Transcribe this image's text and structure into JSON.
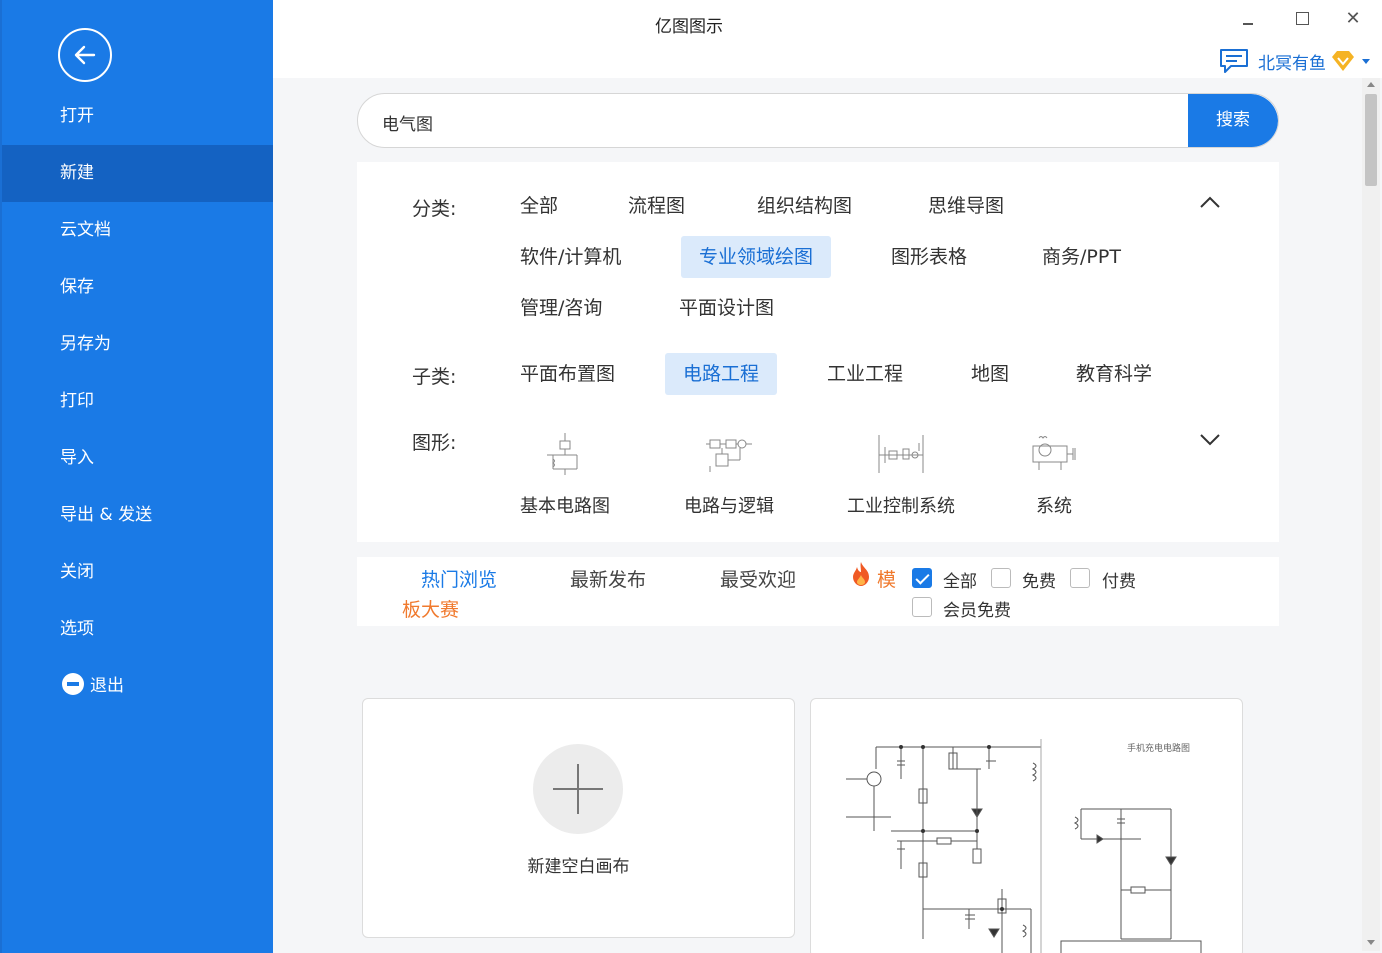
{
  "app": {
    "title": "亿图图示"
  },
  "user": {
    "name": "北冥有鱼"
  },
  "sidebar": {
    "items": [
      {
        "label": "打开",
        "active": false
      },
      {
        "label": "新建",
        "active": true
      },
      {
        "label": "云文档",
        "active": false
      },
      {
        "label": "保存",
        "active": false
      },
      {
        "label": "另存为",
        "active": false
      },
      {
        "label": "打印",
        "active": false
      },
      {
        "label": "导入",
        "active": false
      },
      {
        "label": "导出 & 发送",
        "active": false
      },
      {
        "label": "关闭",
        "active": false
      },
      {
        "label": "选项",
        "active": false
      },
      {
        "label": "退出",
        "active": false
      }
    ]
  },
  "search": {
    "value": "电气图",
    "button_label": "搜索"
  },
  "filters": {
    "category_label": "分类:",
    "categories": [
      "全部",
      "流程图",
      "组织结构图",
      "思维导图",
      "软件/计算机",
      "专业领域绘图",
      "图形表格",
      "商务/PPT",
      "管理/咨询",
      "平面设计图"
    ],
    "category_selected": "专业领域绘图",
    "subcategory_label": "子类:",
    "subcategories": [
      "平面布置图",
      "电路工程",
      "工业工程",
      "地图",
      "教育科学"
    ],
    "subcategory_selected": "电路工程",
    "shapes_label": "图形:",
    "shapes": [
      "基本电路图",
      "电路与逻辑",
      "工业控制系统",
      "系统"
    ]
  },
  "sort": {
    "tabs": [
      "热门浏览",
      "最新发布",
      "最受欢迎"
    ],
    "active_tab": "热门浏览",
    "contest_part1": "模",
    "contest_part2": "板大赛",
    "price_filters": [
      {
        "label": "全部",
        "checked": true
      },
      {
        "label": "免费",
        "checked": false
      },
      {
        "label": "付费",
        "checked": false
      },
      {
        "label": "会员免费",
        "checked": false
      }
    ]
  },
  "cards": {
    "blank_label": "新建空白画布",
    "template_title": "手机充电电路图"
  },
  "colors": {
    "primary": "#1a7ae6",
    "sidebar_active": "#1462c2",
    "chip_selected_bg": "#dbeafb",
    "contest": "#f07a2e"
  }
}
